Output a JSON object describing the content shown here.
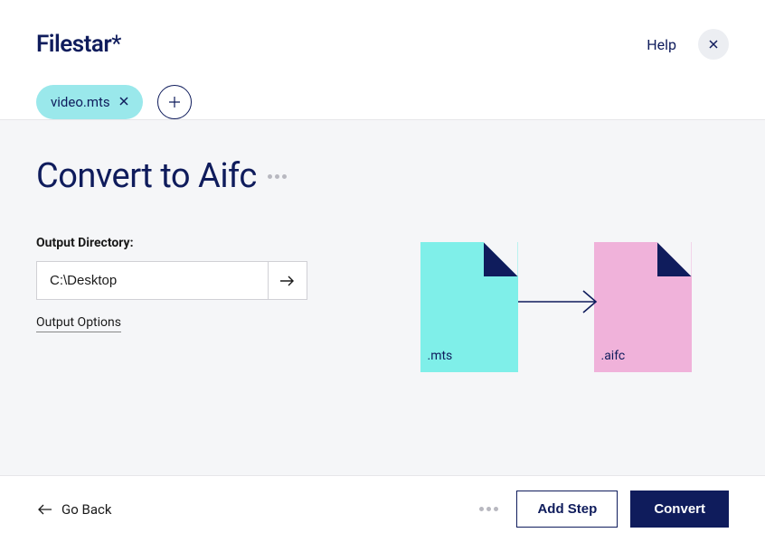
{
  "header": {
    "logo_text": "Filestar",
    "logo_star": "*",
    "help_label": "Help"
  },
  "file_chip": {
    "label": "video.mts"
  },
  "main": {
    "title": "Convert to Aifc",
    "output_dir_label": "Output Directory:",
    "output_dir_value": "C:\\Desktop",
    "output_options_label": "Output Options"
  },
  "diagram": {
    "src_ext": ".mts",
    "dst_ext": ".aifc"
  },
  "footer": {
    "go_back_label": "Go Back",
    "add_step_label": "Add Step",
    "convert_label": "Convert"
  }
}
